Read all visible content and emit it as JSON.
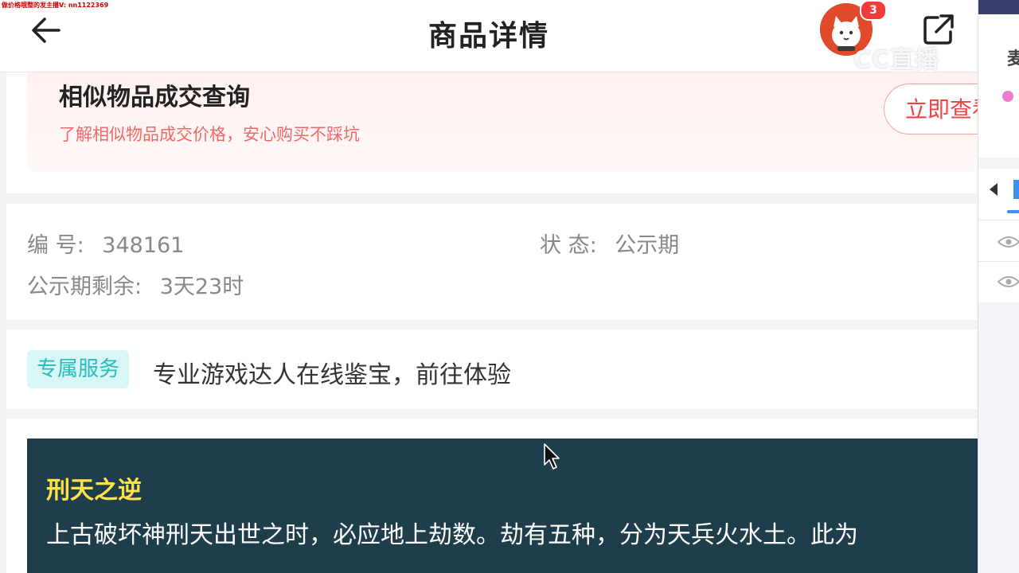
{
  "watermark": {
    "top_left": "做价格哦整的发主播V: nn1122369",
    "stream_logo": "CC直播"
  },
  "header": {
    "title": "商品详情",
    "notification_count": "3"
  },
  "similar": {
    "title": "相似物品成交查询",
    "subtitle": "了解相似物品成交价格，安心购买不踩坑",
    "button_label": "立即查看"
  },
  "info": {
    "id_label": "编 号:",
    "id_value": "348161",
    "status_label": "状 态:",
    "status_value": "公示期",
    "remain_label": "公示期剩余:",
    "remain_value": "3天23时"
  },
  "service": {
    "tag": "专属服务",
    "text": "专业游戏达人在线鉴宝，前往体验"
  },
  "description": {
    "title": "刑天之逆",
    "line1": "上古破坏神刑天出世之时，必应地上劫数。劫有五种，分为天兵火水土。此为"
  },
  "side": {
    "char": "麦"
  },
  "colors": {
    "accent_red": "#ee4444",
    "service_teal": "#27bcbc",
    "desc_bg": "#1f3e4b",
    "desc_title": "#ffe24a"
  }
}
